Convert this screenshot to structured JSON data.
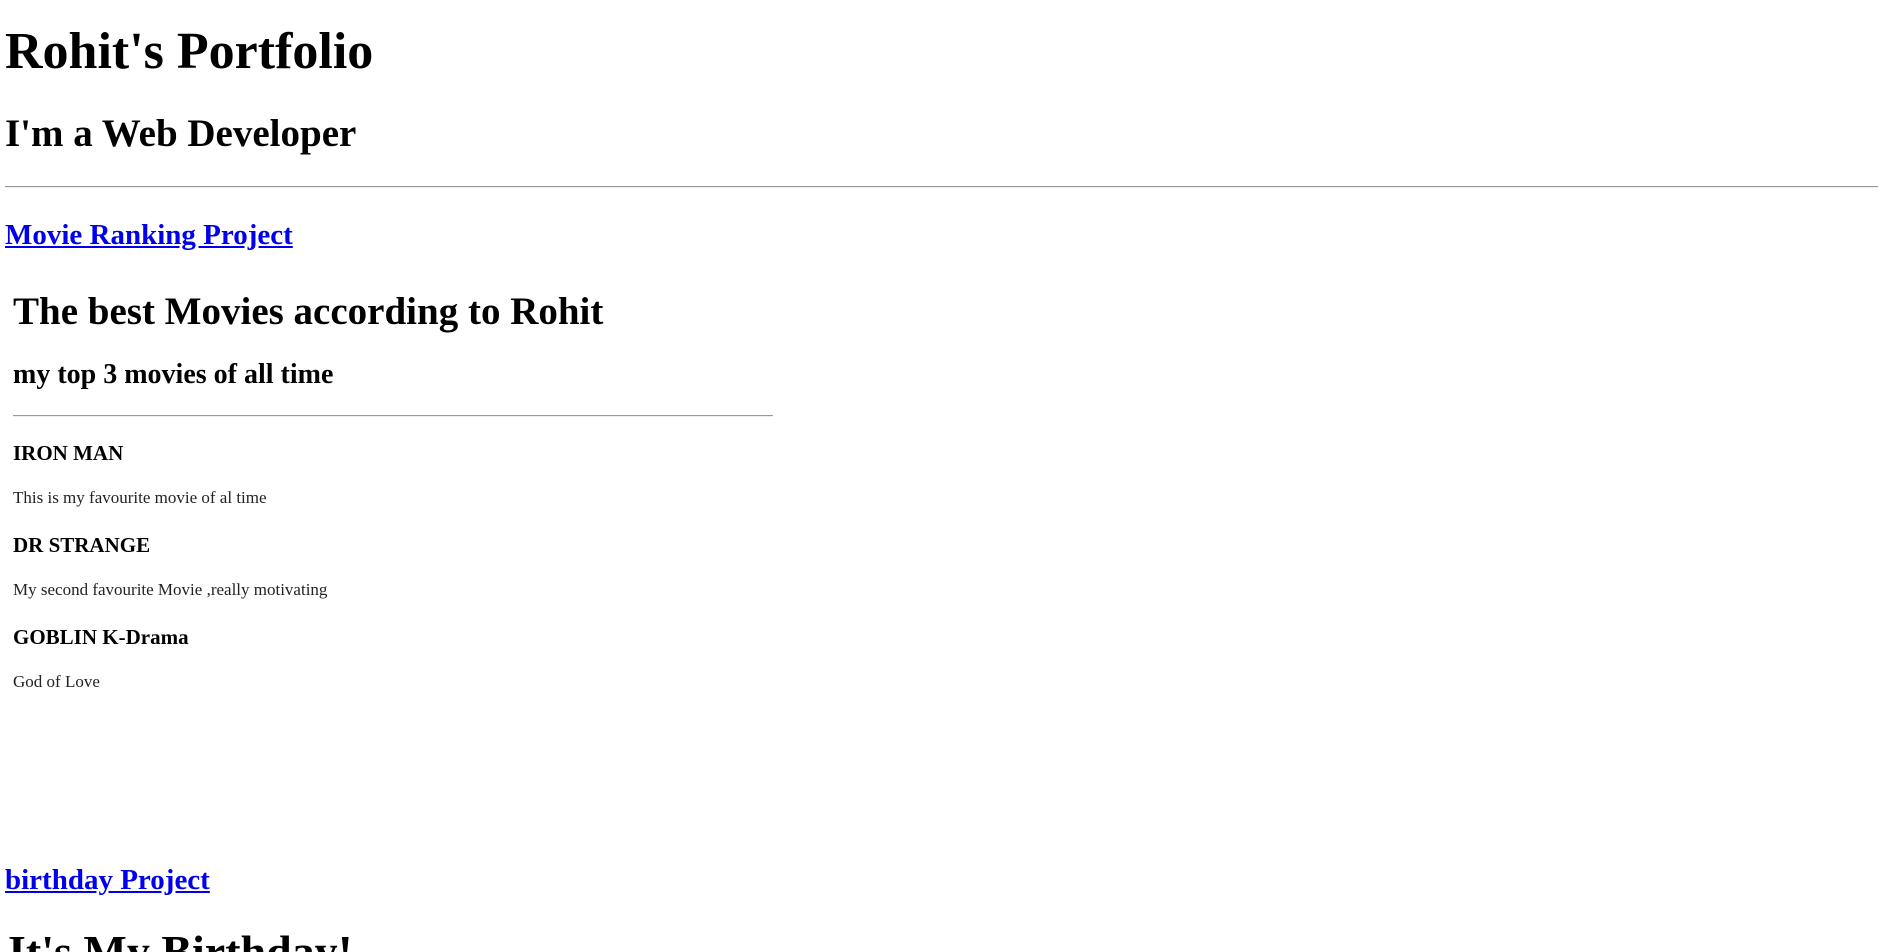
{
  "header": {
    "title": "Rohit's Portfolio",
    "subtitle": "I'm a Web Developer"
  },
  "projects": [
    {
      "link_label": "Movie Ranking Project",
      "embed": {
        "title": "The best Movies according to Rohit",
        "subtitle": "my top 3 movies of all time",
        "movies": [
          {
            "name": "IRON MAN",
            "description": "This is my favourite movie of al time"
          },
          {
            "name": "DR STRANGE",
            "description": "My second favourite Movie ,really motivating"
          },
          {
            "name": "GOBLIN K-Drama",
            "description": "God of Love"
          }
        ]
      }
    },
    {
      "link_label": "birthday Project",
      "embed": {
        "title": "It's My Birthday!"
      }
    }
  ]
}
